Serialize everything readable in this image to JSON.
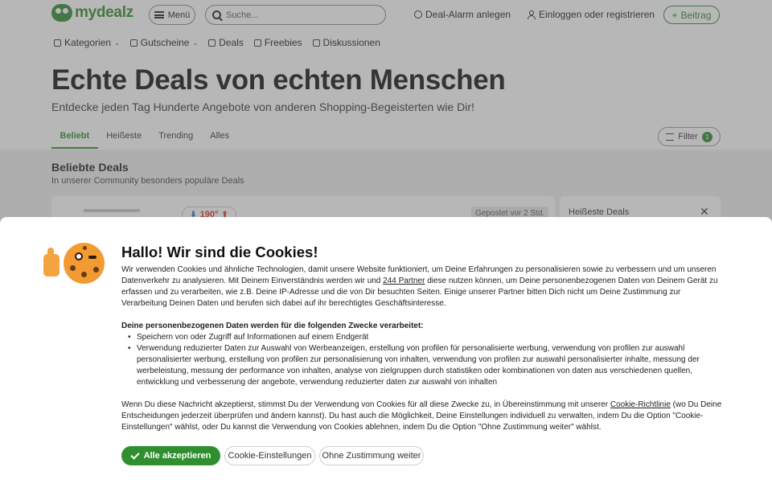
{
  "header": {
    "logo_text": "mydealz",
    "menu_label": "Menü",
    "search_placeholder": "Suche...",
    "deal_alarm": "Deal-Alarm anlegen",
    "login": "Einloggen oder registrieren",
    "post_label": "Beitrag"
  },
  "subnav": [
    {
      "label": "Kategorien",
      "icon": "grid-icon"
    },
    {
      "label": "Gutscheine",
      "icon": "voucher-icon"
    },
    {
      "label": "Deals",
      "icon": "tag-icon"
    },
    {
      "label": "Freebies",
      "icon": "gift-icon"
    },
    {
      "label": "Diskussionen",
      "icon": "chat-icon"
    }
  ],
  "hero": {
    "title": "Echte Deals von echten Menschen",
    "subtitle": "Entdecke jeden Tag Hunderte Angebote von anderen Shopping-Begeisterten wie Dir!"
  },
  "tabs": [
    "Beliebt",
    "Heißeste",
    "Trending",
    "Alles"
  ],
  "filter": {
    "label": "Filter",
    "count": "1"
  },
  "popular": {
    "title": "Beliebte Deals",
    "subtitle": "In unserer Community besonders populäre Deals"
  },
  "deal_card": {
    "temperature": "190°",
    "posted": "Gepostet vor 2 Std."
  },
  "side_card": {
    "title": "Heißeste Deals"
  },
  "cookie": {
    "title": "Hallo! Wir sind die Cookies!",
    "intro_a": "Wir verwenden Cookies und ähnliche Technologien, damit unsere Website funktioniert, um Deine Erfahrungen zu personalisieren sowie zu verbessern und um unseren Datenverkehr zu analysieren. Mit Deinem Einverständnis werden wir und ",
    "partners_link": "244 Partner",
    "intro_b": " diese nutzen können, um Deine personenbezogenen Daten von Deinem Gerät zu erfassen und zu verarbeiten, wie z.B. Deine IP-Adresse und die von Dir besuchten Seiten. Einige unserer Partner bitten Dich nicht um Deine Zustimmung zur Verarbeitung Deinen Daten und berufen sich dabei auf ihr berechtigtes Geschäftsinteresse.",
    "purposes_heading": "Deine personenbezogenen Daten werden für die folgenden Zwecke verarbeitet:",
    "purposes": [
      "Speichern von oder Zugriff auf Informationen auf einem Endgerät",
      "Verwendung reduzierter Daten zur Auswahl von Werbeanzeigen, erstellung von profilen für personalisierte werbung, verwendung von profilen zur auswahl personalisierter werbung, erstellung von profilen zur personalisierung von inhalten, verwendung von profilen zur auswahl personalisierter inhalte, messung der werbeleistung, messung der performance von inhalten, analyse von zielgruppen durch statistiken oder kombinationen von daten aus verschiedenen quellen, entwicklung und verbesserung der angebote, verwendung reduzierter daten zur auswahl von inhalten"
    ],
    "outro_a": "Wenn Du diese Nachricht akzeptierst, stimmst Du der Verwendung von Cookies für all diese Zwecke zu, in Übereinstimmung mit unserer ",
    "policy_link": "Cookie-Richtlinie",
    "outro_b": " (wo Du Deine Entscheidungen jederzeit überprüfen und ändern kannst). Du hast auch die Möglichkeit, Deine Einstellungen individuell zu verwalten, indem Du die Option \"Cookie-Einstellungen\" wählst, oder Du kannst die Verwendung von Cookies ablehnen, indem Du die Option \"Ohne Zustimmung weiter\" wählst.",
    "accept": "Alle akzeptieren",
    "settings": "Cookie-Einstellungen",
    "reject": "Ohne Zustimmung weiter"
  },
  "colors": {
    "brand_green": "#2c8a2c",
    "hot_red": "#d8362a",
    "cold_blue": "#2b6fd6"
  }
}
